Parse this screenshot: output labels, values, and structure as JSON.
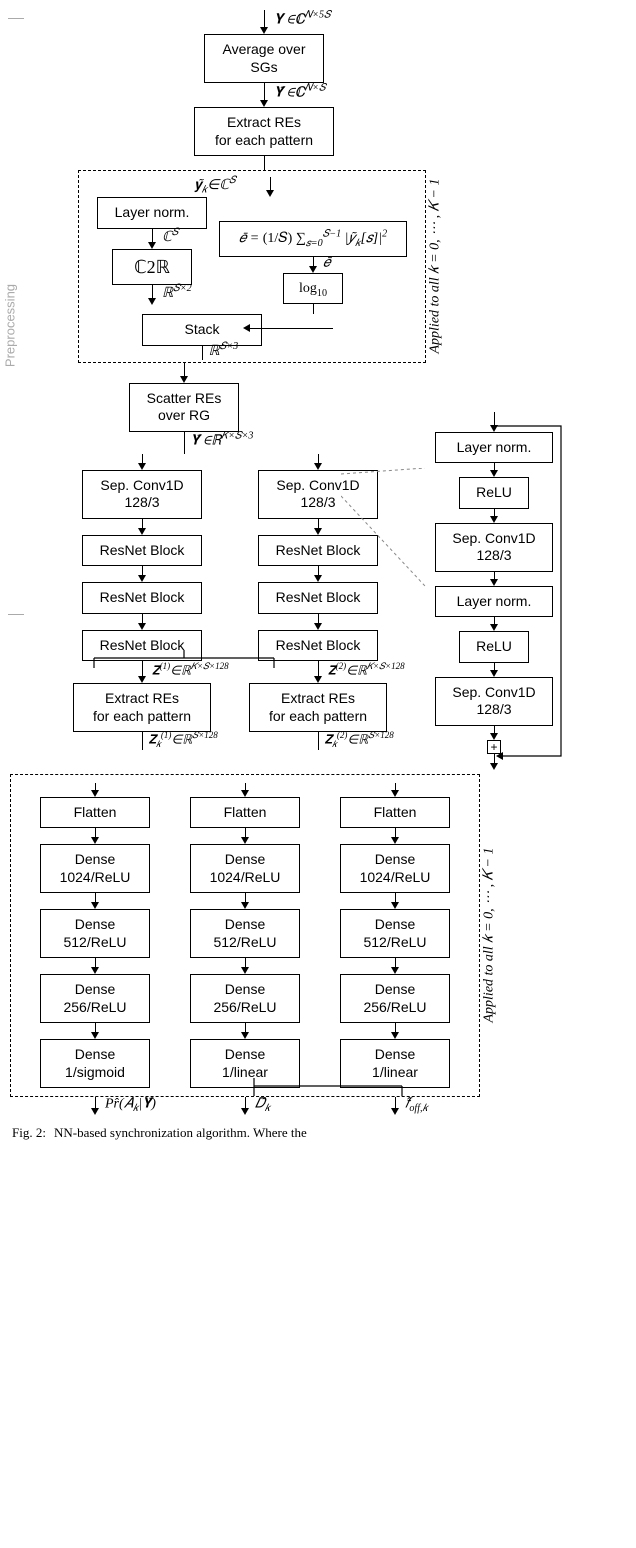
{
  "inputs": {
    "Y": "𝐘 ∈ℂ<sup>𝑁×5𝑆</sup>",
    "Ytilde": "𝐘̃ ∈ℂ<sup>𝑁×𝑆</sup>",
    "ytilde_k": "𝐲̃<sub>𝑘</sub>∈ℂ<sup>𝑆</sup>",
    "CS": "ℂ<sup>𝑆</sup>",
    "RSx2": "ℝ<sup>𝑆×2</sup>",
    "RSx3": "ℝ<sup>𝑆×3</sup>",
    "Ybar": "𝐘̄ ∈ℝ<sup>𝐾×𝑆×3</sup>",
    "Z1": "𝐙<sup>(1)</sup>∈ℝ<sup>𝐾×𝑆×128</sup>",
    "Z2": "𝐙<sup>(2)</sup>∈ℝ<sup>𝐾×𝑆×128</sup>",
    "Z1k": "𝐙<sub>𝑘</sub><sup>(1)</sup>∈ℝ<sup>𝑆×128</sup>",
    "Z2k": "𝐙<sub>𝑘</sub><sup>(2)</sup>∈ℝ<sup>𝑆×128</sup>",
    "ebar": "𝑒̄"
  },
  "blocks": {
    "avg": [
      "Average over",
      "SGs"
    ],
    "extractRE": [
      "Extract REs",
      "for each pattern"
    ],
    "layernorm": "Layer norm.",
    "c2r": "ℂ2ℝ",
    "stack": "Stack",
    "log10": "log<sub>10</sub>",
    "energy": "𝑒̄ = <span class='upright'>(1/𝑆)</span> ∑<sub>𝑠=0</sub><sup>𝑆−1</sup> |𝑦̃<sub>𝑘</sub>[𝑠]|<sup>2</sup>",
    "scatter": [
      "Scatter REs",
      "over RG"
    ],
    "sepconv": [
      "Sep. Conv1D",
      "128/3"
    ],
    "resnet": "ResNet Block",
    "flatten": "Flatten",
    "dense1024": [
      "Dense",
      "1024/ReLU"
    ],
    "dense512": [
      "Dense",
      "512/ReLU"
    ],
    "dense256": [
      "Dense",
      "256/ReLU"
    ],
    "dense1sig": [
      "Dense",
      "1/sigmoid"
    ],
    "dense1lin": [
      "Dense",
      "1/linear"
    ],
    "relu": "ReLU"
  },
  "outputs": {
    "pr": "Pr̂(𝐴<sub>𝑘</sub>|𝐘̄)",
    "Dk": "𝐷̂<sub>𝑘</sub>",
    "foff": "𝑓̂<sub>off,𝑘</sub>"
  },
  "labels": {
    "applied": "Applied to all  𝑘 = 0, ⋯ , 𝐾 − 1",
    "preproc": "Preprocessing"
  },
  "caption_prefix": "Fig. 2:",
  "caption_text": "NN-based synchronization algorithm. Where the"
}
